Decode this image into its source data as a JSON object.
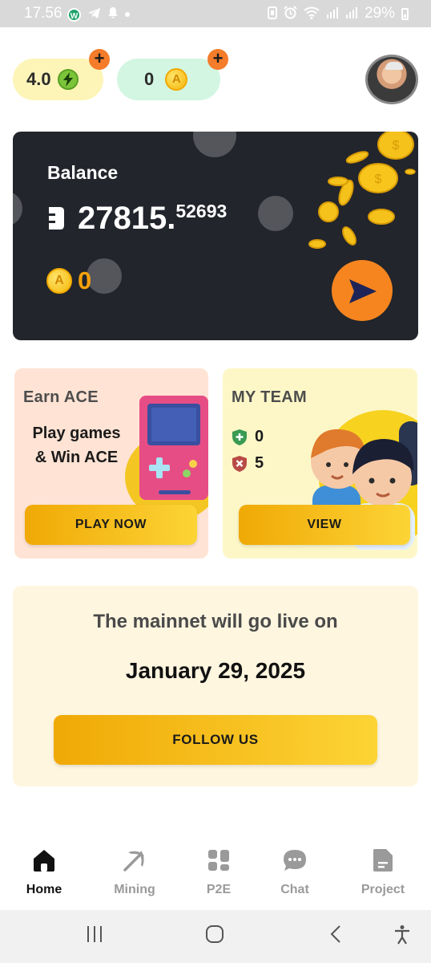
{
  "status_bar": {
    "time": "17.56",
    "badge_letter": "W",
    "battery": "29%",
    "icons": [
      "w-app-icon",
      "telegram-icon",
      "notification-bell-icon",
      "dot-icon",
      "nfc-icon",
      "alarm-icon",
      "wifi-icon",
      "signal-icon",
      "signal-icon",
      "battery-icon"
    ]
  },
  "top_bar": {
    "energy": {
      "value": "4.0",
      "icon": "lightning-icon"
    },
    "coins": {
      "value": "0",
      "icon": "ace-coin-icon",
      "coin_letter": "A"
    },
    "plus_label": "+",
    "avatar": "user-avatar"
  },
  "balance_card": {
    "label": "Balance",
    "integer": "27815.",
    "decimals": "52693",
    "ace_value": "0",
    "coin_letter": "A",
    "send_icon": "send-arrow-icon"
  },
  "earn_card": {
    "title": "Earn ACE",
    "text_line1": "Play games",
    "text_line2": "& Win ACE",
    "button": "PLAY NOW"
  },
  "team_card": {
    "title": "MY TEAM",
    "active": "0",
    "inactive": "5",
    "button": "VIEW"
  },
  "mainnet_card": {
    "text": "The mainnet will go live on",
    "date": "January 29, 2025",
    "button": "FOLLOW US"
  },
  "bottom_nav": {
    "items": [
      {
        "label": "Home",
        "icon": "home-icon",
        "active": true
      },
      {
        "label": "Mining",
        "icon": "pickaxe-icon",
        "active": false
      },
      {
        "label": "P2E",
        "icon": "grid-icon",
        "active": false
      },
      {
        "label": "Chat",
        "icon": "chat-icon",
        "active": false
      },
      {
        "label": "Project",
        "icon": "document-icon",
        "active": false
      }
    ]
  },
  "colors": {
    "accent_orange": "#f6851f",
    "gold": "#f0a906",
    "card_dark": "#22252b"
  }
}
